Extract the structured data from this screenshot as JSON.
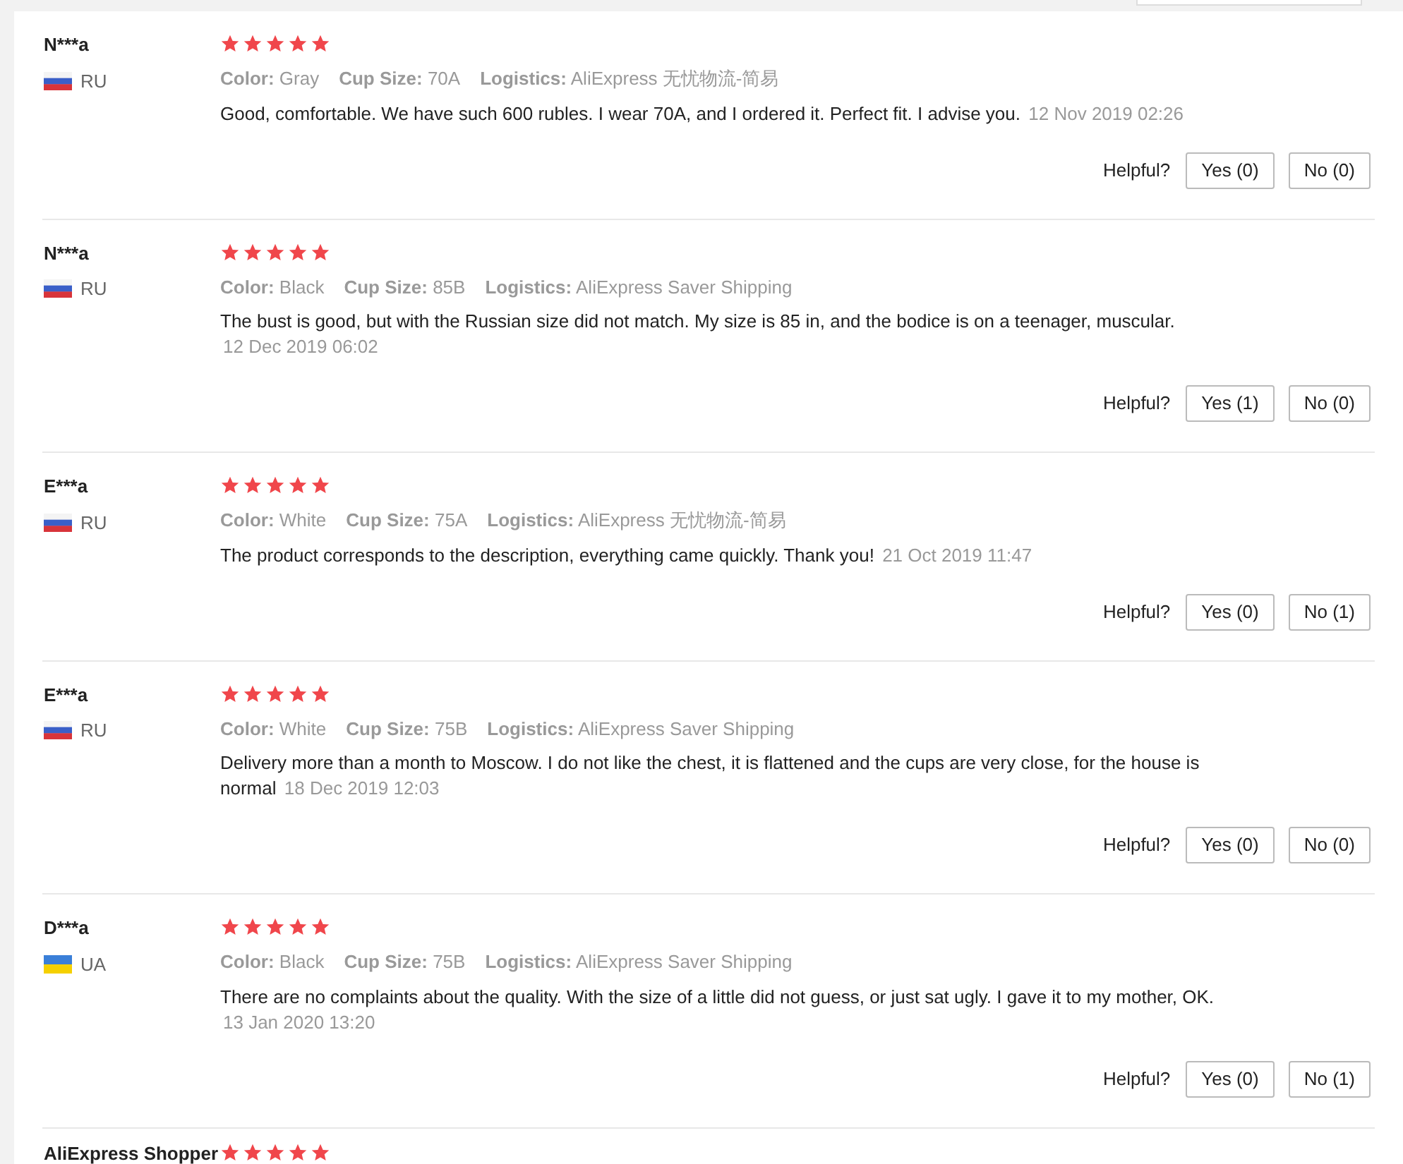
{
  "reviews": [
    {
      "name": "N***a",
      "flag": {
        "kind": "russia"
      },
      "country": "RU",
      "stars": 5,
      "attributes": [
        {
          "label": "Color:",
          "value": "Gray"
        },
        {
          "label": "Cup Size:",
          "value": "70A"
        },
        {
          "label": "Logistics:",
          "value": "AliExpress 无忧物流-简易"
        }
      ],
      "text": "Good, comfortable. We have such 600 rubles. I wear 70A, and I ordered it. Perfect fit. I advise you.",
      "date": "12 Nov 2019 02:26",
      "helpful": "Helpful?",
      "yes": "Yes (0)",
      "no": "No (0)"
    },
    {
      "name": "N***a",
      "flag": {
        "kind": "russia"
      },
      "country": "RU",
      "stars": 5,
      "attributes": [
        {
          "label": "Color:",
          "value": "Black"
        },
        {
          "label": "Cup Size:",
          "value": "85B"
        },
        {
          "label": "Logistics:",
          "value": "AliExpress Saver Shipping"
        }
      ],
      "text": "The bust is good, but with the Russian size did not match. My size is 85 in, and the bodice is on a teenager, muscular.",
      "date": "12 Dec 2019 06:02",
      "helpful": "Helpful?",
      "yes": "Yes (1)",
      "no": "No (0)"
    },
    {
      "name": "E***a",
      "flag": {
        "kind": "russia"
      },
      "country": "RU",
      "stars": 5,
      "attributes": [
        {
          "label": "Color:",
          "value": "White"
        },
        {
          "label": "Cup Size:",
          "value": "75A"
        },
        {
          "label": "Logistics:",
          "value": "AliExpress 无忧物流-简易"
        }
      ],
      "text": "The product corresponds to the description, everything came quickly. Thank you!",
      "date": "21 Oct 2019 11:47",
      "helpful": "Helpful?",
      "yes": "Yes (0)",
      "no": "No (1)"
    },
    {
      "name": "E***a",
      "flag": {
        "kind": "russia"
      },
      "country": "RU",
      "stars": 5,
      "attributes": [
        {
          "label": "Color:",
          "value": "White"
        },
        {
          "label": "Cup Size:",
          "value": "75B"
        },
        {
          "label": "Logistics:",
          "value": "AliExpress Saver Shipping"
        }
      ],
      "text": "Delivery more than a month to Moscow. I do not like the chest, it is flattened and the cups are very close, for the house is normal",
      "date": "18 Dec 2019 12:03",
      "helpful": "Helpful?",
      "yes": "Yes (0)",
      "no": "No (0)"
    },
    {
      "name": "D***a",
      "flag": {
        "kind": "ukraine"
      },
      "country": "UA",
      "stars": 5,
      "attributes": [
        {
          "label": "Color:",
          "value": "Black"
        },
        {
          "label": "Cup Size:",
          "value": "75B"
        },
        {
          "label": "Logistics:",
          "value": "AliExpress Saver Shipping"
        }
      ],
      "text": "There are no complaints about the quality. With the size of a little did not guess, or just sat ugly. I gave it to my mother, OK.",
      "date": "13 Jan 2020 13:20",
      "helpful": "Helpful?",
      "yes": "Yes (0)",
      "no": "No (1)"
    },
    {
      "name": "AliExpress Shopper",
      "stars": 5
    }
  ]
}
